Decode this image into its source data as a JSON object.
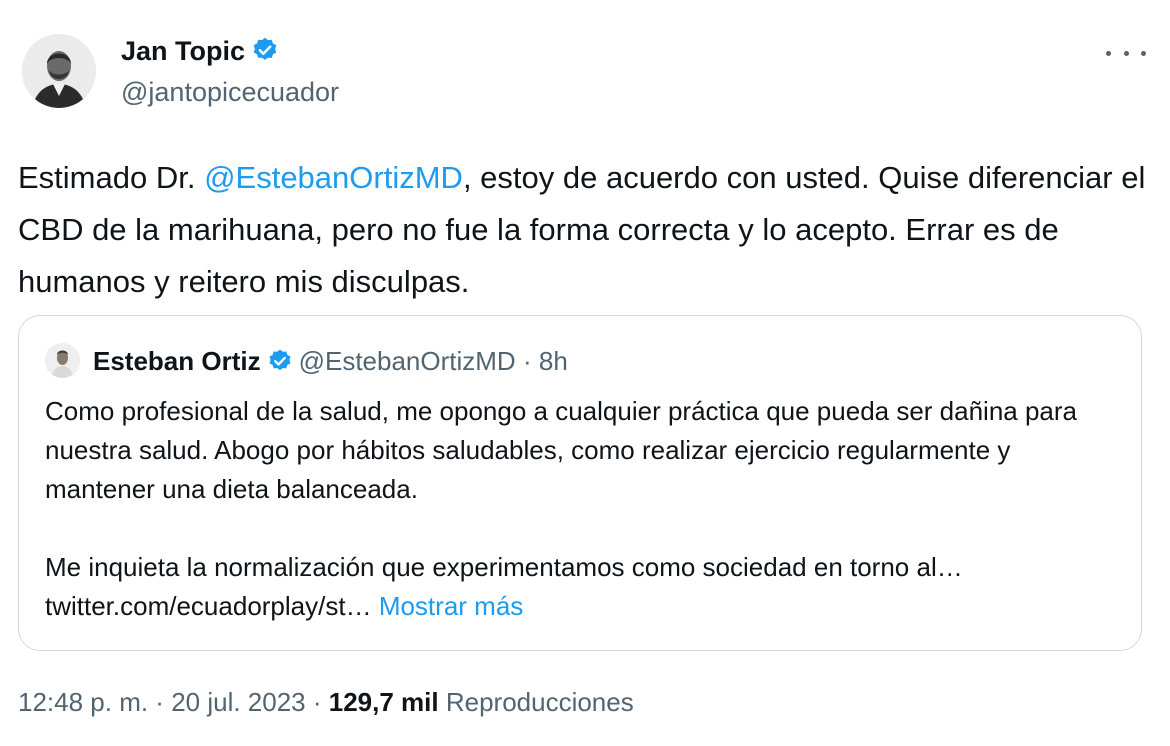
{
  "author": {
    "name": "Jan Topic",
    "handle": "@jantopicecuador",
    "verified": true
  },
  "tweet": {
    "text_prefix": "Estimado Dr. ",
    "mention": "@EstebanOrtizMD",
    "text_suffix": ", estoy de acuerdo con usted. Quise diferenciar el CBD de la marihuana, pero no fue la forma correcta y lo acepto. Errar es de humanos y reitero mis disculpas."
  },
  "quote": {
    "name": "Esteban Ortiz",
    "handle": "@EstebanOrtizMD",
    "separator": "·",
    "time": "8h",
    "paragraph1": "Como profesional de la salud, me opongo a cualquier práctica que pueda ser dañina para nuestra salud. Abogo por hábitos saludables, como realizar ejercicio regularmente y mantener una dieta balanceada.",
    "paragraph2": "Me inquieta la normalización que experimentamos como sociedad en torno al… twitter.com/ecuadorplay/st…",
    "show_more": "Mostrar más"
  },
  "meta": {
    "time": "12:48 p. m.",
    "separator1": " · ",
    "date": "20 jul. 2023",
    "separator2": " · ",
    "views_count": "129,7 mil",
    "views_label": " Reproducciones"
  },
  "colors": {
    "accent": "#1d9bf0",
    "secondary_text": "#536471",
    "border": "#cfd9de"
  },
  "icons": [
    "verified-badge-icon",
    "more-options-icon"
  ]
}
